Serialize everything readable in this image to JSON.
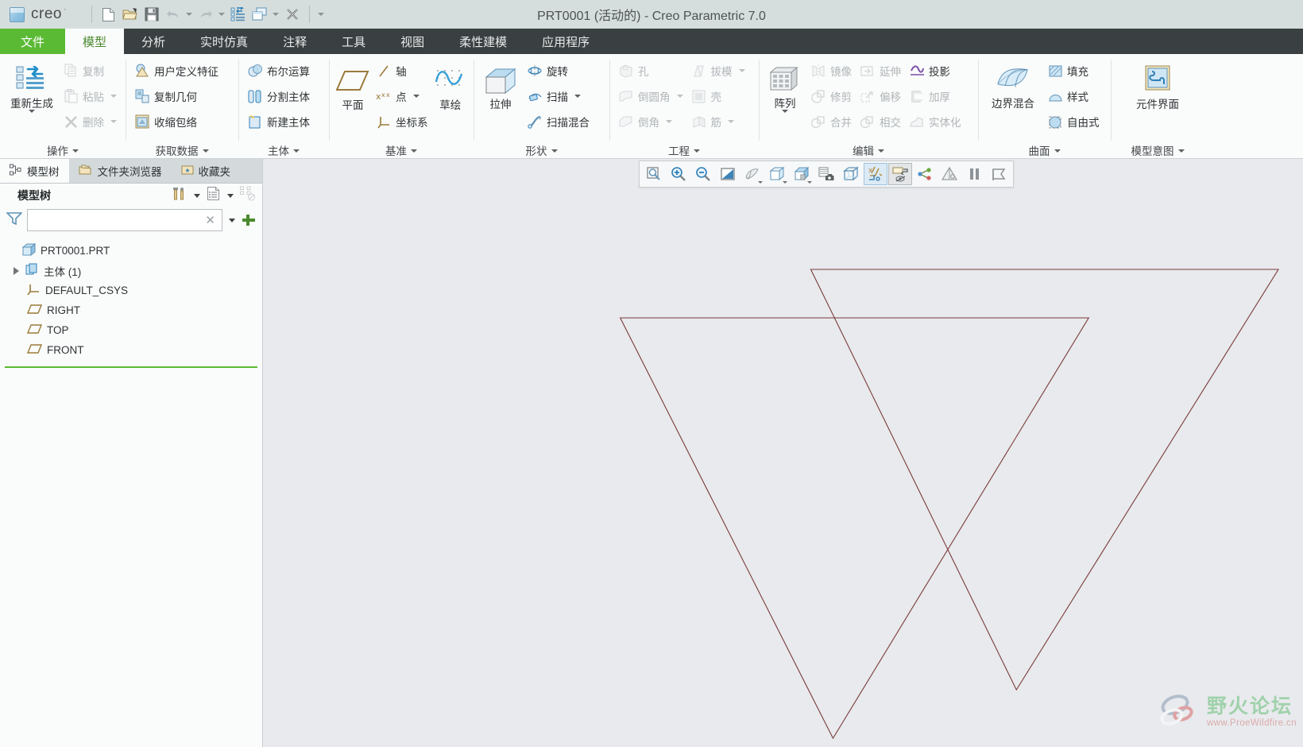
{
  "window": {
    "title": "PRT0001 (活动的) - Creo Parametric 7.0",
    "brand": "creo",
    "brand_mark": "creo-cube-icon"
  },
  "quick_access": [
    {
      "name": "new-file-button",
      "icon": "new-document-icon"
    },
    {
      "name": "open-file-button",
      "icon": "open-folder-icon"
    },
    {
      "name": "save-button",
      "icon": "save-disk-icon"
    },
    {
      "name": "undo-button",
      "icon": "undo-arrow-icon",
      "has_dropdown": true
    },
    {
      "name": "redo-button",
      "icon": "redo-arrow-icon",
      "has_dropdown": true
    },
    {
      "name": "regenerate-button",
      "icon": "regenerate-list-icon"
    },
    {
      "name": "window-button",
      "icon": "windows-stack-icon",
      "has_dropdown": true
    },
    {
      "name": "close-window-button",
      "icon": "close-x-icon"
    }
  ],
  "ribbon_tabs": [
    {
      "label": "文件",
      "id": "file",
      "state": "file"
    },
    {
      "label": "模型",
      "id": "model",
      "state": "active"
    },
    {
      "label": "分析",
      "id": "analysis",
      "state": "normal"
    },
    {
      "label": "实时仿真",
      "id": "live-simulation",
      "state": "normal"
    },
    {
      "label": "注释",
      "id": "annotate",
      "state": "normal"
    },
    {
      "label": "工具",
      "id": "tools",
      "state": "normal"
    },
    {
      "label": "视图",
      "id": "view",
      "state": "normal"
    },
    {
      "label": "柔性建模",
      "id": "flexible-modeling",
      "state": "normal"
    },
    {
      "label": "应用程序",
      "id": "applications",
      "state": "normal"
    }
  ],
  "ribbon_groups": [
    {
      "id": "operations",
      "label": "操作",
      "big": {
        "label": "重新生成",
        "icon": "regenerate-icon",
        "dropdown": true
      },
      "items": [
        {
          "label": "复制",
          "icon": "copy-icon",
          "disabled": true,
          "dropdown": false
        },
        {
          "label": "粘贴",
          "icon": "paste-icon",
          "disabled": true,
          "dropdown": true
        },
        {
          "label": "删除",
          "icon": "delete-x-icon",
          "disabled": true,
          "dropdown": true
        }
      ]
    },
    {
      "id": "get-data",
      "label": "获取数据",
      "items": [
        {
          "label": "用户定义特征",
          "icon": "udf-icon",
          "disabled": false
        },
        {
          "label": "复制几何",
          "icon": "copy-geometry-icon",
          "disabled": false
        },
        {
          "label": "收缩包络",
          "icon": "shrinkwrap-icon",
          "disabled": false
        }
      ]
    },
    {
      "id": "body",
      "label": "主体",
      "items": [
        {
          "label": "布尔运算",
          "icon": "boolean-icon",
          "disabled": false
        },
        {
          "label": "分割主体",
          "icon": "split-body-icon",
          "disabled": false
        },
        {
          "label": "新建主体",
          "icon": "new-body-icon",
          "disabled": false
        }
      ]
    },
    {
      "id": "datum",
      "label": "基准",
      "big": {
        "label": "平面",
        "icon": "datum-plane-icon"
      },
      "items": [
        {
          "label": "轴",
          "icon": "datum-axis-icon",
          "disabled": false
        },
        {
          "label": "点",
          "icon": "datum-point-icon",
          "disabled": false,
          "dropdown": true
        },
        {
          "label": "坐标系",
          "icon": "datum-csys-icon",
          "disabled": false
        }
      ],
      "big2": {
        "label": "草绘",
        "icon": "sketch-icon"
      }
    },
    {
      "id": "shapes",
      "label": "形状",
      "big": {
        "label": "拉伸",
        "icon": "extrude-icon"
      },
      "items": [
        {
          "label": "旋转",
          "icon": "revolve-icon",
          "disabled": false
        },
        {
          "label": "扫描",
          "icon": "sweep-icon",
          "disabled": false,
          "dropdown": true
        },
        {
          "label": "扫描混合",
          "icon": "swept-blend-icon",
          "disabled": false
        }
      ]
    },
    {
      "id": "engineering",
      "label": "工程",
      "items_col1": [
        {
          "label": "孔",
          "icon": "hole-icon",
          "disabled": true
        },
        {
          "label": "倒圆角",
          "icon": "round-icon",
          "disabled": true,
          "dropdown": true
        },
        {
          "label": "倒角",
          "icon": "chamfer-icon",
          "disabled": true,
          "dropdown": true
        }
      ],
      "items_col2": [
        {
          "label": "拔模",
          "icon": "draft-icon",
          "disabled": true,
          "dropdown": true
        },
        {
          "label": "壳",
          "icon": "shell-icon",
          "disabled": true
        },
        {
          "label": "筋",
          "icon": "rib-icon",
          "disabled": true,
          "dropdown": true
        }
      ]
    },
    {
      "id": "editing",
      "label": "编辑",
      "big": {
        "label": "阵列",
        "icon": "pattern-icon",
        "dropdown": true
      },
      "items_col1": [
        {
          "label": "镜像",
          "icon": "mirror-icon",
          "disabled": true
        },
        {
          "label": "修剪",
          "icon": "trim-icon",
          "disabled": true
        },
        {
          "label": "合并",
          "icon": "merge-icon",
          "disabled": true
        }
      ],
      "items_col2": [
        {
          "label": "延伸",
          "icon": "extend-icon",
          "disabled": true
        },
        {
          "label": "偏移",
          "icon": "offset-icon",
          "disabled": true
        },
        {
          "label": "相交",
          "icon": "intersect-icon",
          "disabled": true
        }
      ],
      "items_col3": [
        {
          "label": "投影",
          "icon": "project-icon",
          "disabled": false
        },
        {
          "label": "加厚",
          "icon": "thicken-icon",
          "disabled": true
        },
        {
          "label": "实体化",
          "icon": "solidify-icon",
          "disabled": true
        }
      ]
    },
    {
      "id": "surfaces",
      "label": "曲面",
      "big": {
        "label": "边界混合",
        "icon": "boundary-blend-icon"
      },
      "items": [
        {
          "label": "填充",
          "icon": "fill-icon",
          "disabled": false
        },
        {
          "label": "样式",
          "icon": "style-icon",
          "disabled": false
        },
        {
          "label": "自由式",
          "icon": "freestyle-icon",
          "disabled": false
        }
      ]
    },
    {
      "id": "model-intent",
      "label": "模型意图",
      "big": {
        "label": "元件界面",
        "icon": "component-interface-icon"
      }
    }
  ],
  "left_panel": {
    "nav_tabs": [
      {
        "label": "模型树",
        "icon": "model-tree-icon",
        "active": true
      },
      {
        "label": "文件夹浏览器",
        "icon": "folder-browser-icon",
        "active": false
      },
      {
        "label": "收藏夹",
        "icon": "favorites-icon",
        "active": false
      }
    ],
    "header": {
      "title": "模型树",
      "tools_icon": "tree-tools-icon",
      "display_icon": "tree-display-icon",
      "hide_icon": "tree-hide-icon"
    },
    "filter": {
      "icon": "filter-funnel-icon",
      "value": "",
      "placeholder": "",
      "clear_icon": "clear-x-icon",
      "dropdown_icon": "chevron-down-icon",
      "add_icon": "add-plus-icon"
    },
    "tree": [
      {
        "label": "PRT0001.PRT",
        "icon": "part-icon",
        "indent": 0,
        "expandable": false
      },
      {
        "label": "主体 (1)",
        "icon": "bodies-icon",
        "indent": 1,
        "expandable": true
      },
      {
        "label": "DEFAULT_CSYS",
        "icon": "csys-icon",
        "indent": 2,
        "expandable": false
      },
      {
        "label": "RIGHT",
        "icon": "plane-icon",
        "indent": 2,
        "expandable": false
      },
      {
        "label": "TOP",
        "icon": "plane-icon",
        "indent": 2,
        "expandable": false
      },
      {
        "label": "FRONT",
        "icon": "plane-icon",
        "indent": 2,
        "expandable": false
      }
    ],
    "insert_indicator_color": "#5bba34"
  },
  "graphics_toolbar": [
    {
      "name": "refit-button",
      "icon": "zoom-fit-icon",
      "state": "normal"
    },
    {
      "name": "zoom-in-button",
      "icon": "zoom-in-icon",
      "state": "normal"
    },
    {
      "name": "zoom-out-button",
      "icon": "zoom-out-icon",
      "state": "normal"
    },
    {
      "name": "repaint-button",
      "icon": "repaint-icon",
      "state": "normal"
    },
    {
      "name": "perspective-view-button",
      "icon": "perspective-icon",
      "state": "normal"
    },
    {
      "name": "saved-orientations-button",
      "icon": "saved-view-cube-icon",
      "state": "normal",
      "dropdown": true
    },
    {
      "name": "view-manager-button",
      "icon": "view-manager-icon",
      "state": "normal",
      "dropdown": true
    },
    {
      "name": "appearance-gallery-button",
      "icon": "appearance-camera-icon",
      "state": "normal"
    },
    {
      "name": "display-style-button",
      "icon": "display-style-wire-icon",
      "state": "normal"
    },
    {
      "name": "datum-display-filters-button",
      "icon": "datum-display-icon",
      "state": "selected"
    },
    {
      "name": "annotation-display-button",
      "icon": "annotation-display-icon",
      "state": "selected2"
    },
    {
      "name": "spin-center-button",
      "icon": "spin-center-icon",
      "state": "normal"
    },
    {
      "name": "orientation-mode-button",
      "icon": "orientation-mode-icon",
      "state": "normal"
    },
    {
      "name": "pause-button",
      "icon": "pause-icon",
      "state": "normal"
    },
    {
      "name": "stop-button",
      "icon": "stop-flag-icon",
      "state": "normal"
    }
  ],
  "viewport": {
    "background_color": "#e8eaed",
    "geometry_color": "#7a3b3b",
    "geometry_name": "hexagram-sketch"
  },
  "watermark": {
    "title": "野火论坛",
    "url": "www.ProeWildfire.cn",
    "logo": "wildfire-rings-logo"
  }
}
